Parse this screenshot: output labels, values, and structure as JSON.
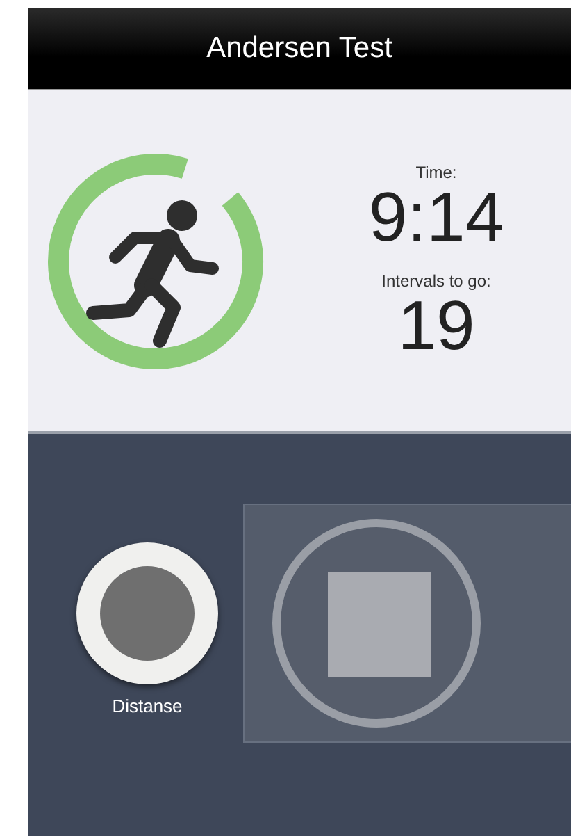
{
  "window": {
    "title": "Andersen Test"
  },
  "stats": [
    {
      "label": "Time:",
      "value": "9:14"
    },
    {
      "label": "Intervals to go:",
      "value": "19"
    }
  ],
  "controls": [
    {
      "kind": "record",
      "label": "Distanse"
    },
    {
      "kind": "stop"
    }
  ]
}
